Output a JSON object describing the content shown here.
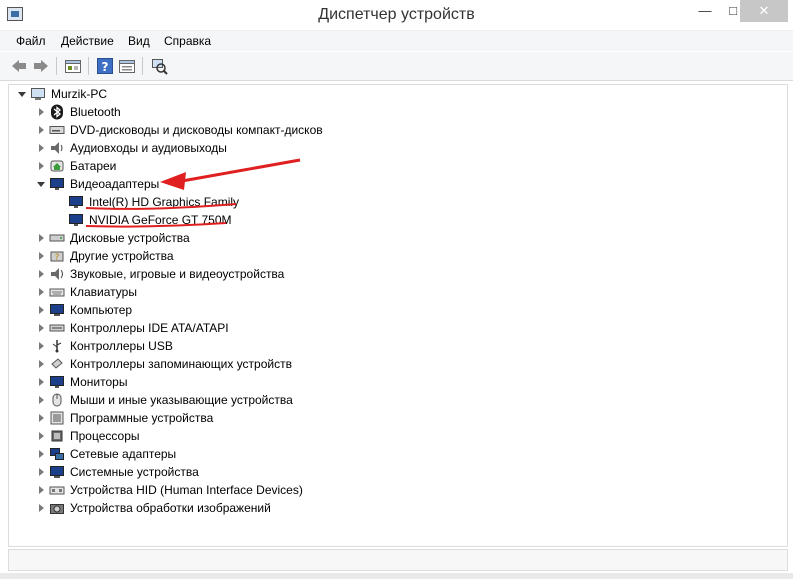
{
  "window": {
    "title": "Диспетчер устройств",
    "controls": {
      "minimize": "—",
      "maximize": "□",
      "close": "✕"
    }
  },
  "menu": [
    "Файл",
    "Действие",
    "Вид",
    "Справка"
  ],
  "toolbar": {
    "buttons": [
      "back-icon",
      "forward-icon",
      "properties-icon",
      "help-icon",
      "view-icon",
      "scan-hardware-icon"
    ]
  },
  "tree": {
    "root": "Murzik-PC",
    "categories": [
      {
        "label": "Bluetooth",
        "icon": "bluetooth-icon"
      },
      {
        "label": "DVD-дисководы и дисководы компакт-дисков",
        "icon": "dvd-drive-icon"
      },
      {
        "label": "Аудиовходы и аудиовыходы",
        "icon": "speaker-icon"
      },
      {
        "label": "Батареи",
        "icon": "battery-icon"
      },
      {
        "label": "Видеоадаптеры",
        "icon": "monitor-icon",
        "expanded": true,
        "children": [
          "Intel(R) HD Graphics Family",
          "NVIDIA GeForce GT 750M"
        ]
      },
      {
        "label": "Дисковые устройства",
        "icon": "disk-drive-icon"
      },
      {
        "label": "Другие устройства",
        "icon": "unknown-device-icon"
      },
      {
        "label": "Звуковые, игровые и видеоустройства",
        "icon": "sound-icon"
      },
      {
        "label": "Клавиатуры",
        "icon": "keyboard-icon"
      },
      {
        "label": "Компьютер",
        "icon": "computer-icon"
      },
      {
        "label": "Контроллеры IDE ATA/ATAPI",
        "icon": "ide-controller-icon"
      },
      {
        "label": "Контроллеры USB",
        "icon": "usb-icon"
      },
      {
        "label": "Контроллеры запоминающих устройств",
        "icon": "storage-controller-icon"
      },
      {
        "label": "Мониторы",
        "icon": "monitor-icon"
      },
      {
        "label": "Мыши и иные указывающие устройства",
        "icon": "mouse-icon"
      },
      {
        "label": "Программные устройства",
        "icon": "software-device-icon"
      },
      {
        "label": "Процессоры",
        "icon": "cpu-icon"
      },
      {
        "label": "Сетевые адаптеры",
        "icon": "network-adapter-icon"
      },
      {
        "label": "Системные устройства",
        "icon": "system-device-icon"
      },
      {
        "label": "Устройства HID (Human Interface Devices)",
        "icon": "hid-icon"
      },
      {
        "label": "Устройства обработки изображений",
        "icon": "camera-icon"
      }
    ]
  },
  "annotation": {
    "color": "#e02020"
  }
}
